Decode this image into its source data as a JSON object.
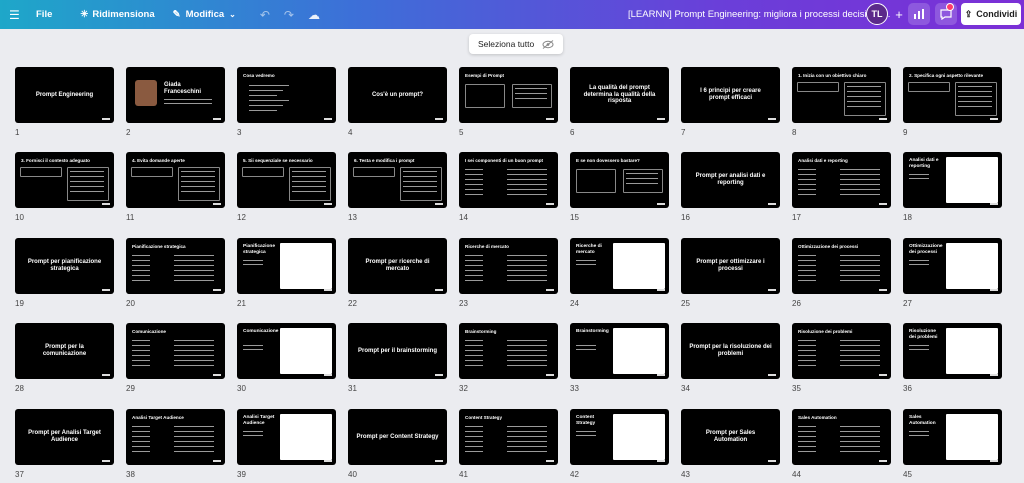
{
  "topbar": {
    "menu_icon": "menu-icon",
    "file": "File",
    "resize": "Ridimensiona",
    "edit": "Modifica",
    "doc_title": "[LEARNN] Prompt Engineering: migliora i processi decisiona...",
    "avatar": "TL",
    "share": "Condividi",
    "colors": {
      "accent_start": "#1ea7c9",
      "accent_end": "#7b2fd6"
    }
  },
  "select_all": "Seleziona tutto",
  "slides": [
    {
      "n": "1",
      "title": "Prompt Engineering",
      "sub": "Migliora i processi decisionali e la produttività con l'AI",
      "kind": "title"
    },
    {
      "n": "2",
      "title": "Giada Franceschini",
      "kind": "person"
    },
    {
      "n": "3",
      "title": "Cosa vedremo",
      "kind": "content"
    },
    {
      "n": "4",
      "title": "Cos'è un prompt?",
      "kind": "title"
    },
    {
      "n": "5",
      "title": "Esempi di Prompt",
      "kind": "boxes"
    },
    {
      "n": "6",
      "title": "La qualità del prompt determina la qualità della risposta",
      "kind": "title"
    },
    {
      "n": "7",
      "title": "I 6 principi per creare prompt efficaci",
      "kind": "title"
    },
    {
      "n": "8",
      "title": "1. Inizia con un obiettivo chiaro",
      "kind": "compare"
    },
    {
      "n": "9",
      "title": "2. Specifica ogni aspetto rilevante",
      "kind": "compare"
    },
    {
      "n": "10",
      "title": "3. Fornisci il contesto adeguato",
      "kind": "compare"
    },
    {
      "n": "11",
      "title": "4. Evita domande aperte",
      "kind": "compare"
    },
    {
      "n": "12",
      "title": "5. Sii sequenziale se necessario",
      "kind": "compare"
    },
    {
      "n": "13",
      "title": "6. Testa e modifica i prompt",
      "kind": "compare"
    },
    {
      "n": "14",
      "title": "I sei componenti di un buon prompt",
      "kind": "list"
    },
    {
      "n": "15",
      "title": "E se non dovessero bastare?",
      "kind": "boxes"
    },
    {
      "n": "16",
      "title": "Prompt per analisi dati e reporting",
      "kind": "title"
    },
    {
      "n": "17",
      "title": "Analisi dati e reporting",
      "kind": "list"
    },
    {
      "n": "18",
      "title": "Analisi dati e reporting",
      "kind": "screen"
    },
    {
      "n": "19",
      "title": "Prompt per pianificazione strategica",
      "kind": "title"
    },
    {
      "n": "20",
      "title": "Pianificazione strategica",
      "kind": "list"
    },
    {
      "n": "21",
      "title": "Pianificazione strategica",
      "kind": "screen"
    },
    {
      "n": "22",
      "title": "Prompt per ricerche di mercato",
      "kind": "title"
    },
    {
      "n": "23",
      "title": "Ricerche di mercato",
      "kind": "list"
    },
    {
      "n": "24",
      "title": "Ricerche di mercato",
      "kind": "screen"
    },
    {
      "n": "25",
      "title": "Prompt per ottimizzare i processi",
      "kind": "title"
    },
    {
      "n": "26",
      "title": "Ottimizzazione dei processi",
      "kind": "list"
    },
    {
      "n": "27",
      "title": "Ottimizzazione dei processi",
      "kind": "screen"
    },
    {
      "n": "28",
      "title": "Prompt per la comunicazione",
      "kind": "title"
    },
    {
      "n": "29",
      "title": "Comunicazione",
      "kind": "list"
    },
    {
      "n": "30",
      "title": "Comunicazione",
      "kind": "screen"
    },
    {
      "n": "31",
      "title": "Prompt per il brainstorming",
      "kind": "title"
    },
    {
      "n": "32",
      "title": "Brainstorming",
      "kind": "list"
    },
    {
      "n": "33",
      "title": "Brainstorming",
      "kind": "screen"
    },
    {
      "n": "34",
      "title": "Prompt per la risoluzione dei problemi",
      "kind": "title"
    },
    {
      "n": "35",
      "title": "Risoluzione dei problemi",
      "kind": "list"
    },
    {
      "n": "36",
      "title": "Risoluzione dei problemi",
      "kind": "screen"
    },
    {
      "n": "37",
      "title": "Prompt per Analisi Target Audience",
      "kind": "title"
    },
    {
      "n": "38",
      "title": "Analisi Target Audience",
      "kind": "list"
    },
    {
      "n": "39",
      "title": "Analisi Target Audience",
      "kind": "screen"
    },
    {
      "n": "40",
      "title": "Prompt per Content Strategy",
      "kind": "title"
    },
    {
      "n": "41",
      "title": "Content Strategy",
      "kind": "list"
    },
    {
      "n": "42",
      "title": "Content Strategy",
      "kind": "screen"
    },
    {
      "n": "43",
      "title": "Prompt per Sales Automation",
      "kind": "title"
    },
    {
      "n": "44",
      "title": "Sales Automation",
      "kind": "list"
    },
    {
      "n": "45",
      "title": "Sales Automation",
      "kind": "screen"
    }
  ]
}
